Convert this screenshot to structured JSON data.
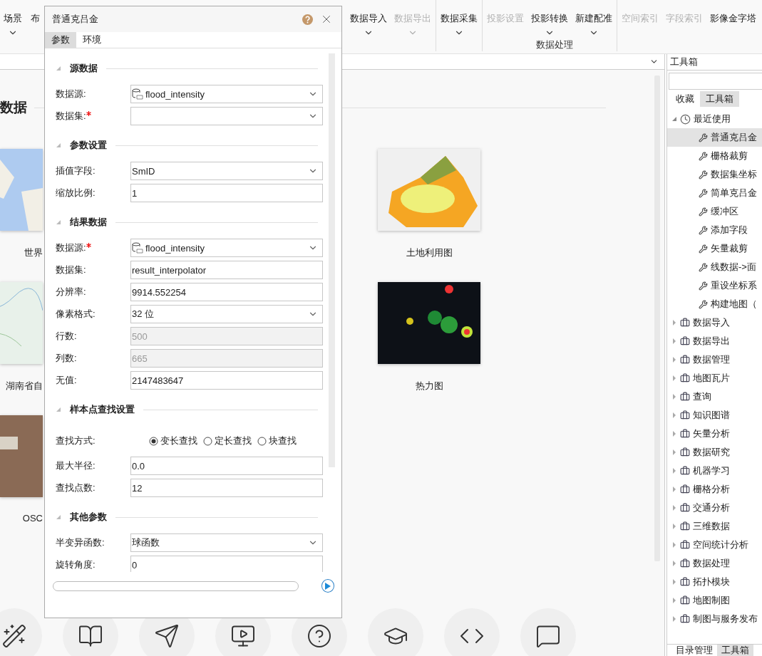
{
  "ribbon": {
    "left_items": [
      {
        "label": "场景",
        "menu": true
      },
      {
        "label": "布",
        "menu": false
      }
    ],
    "items": [
      {
        "kind": "button",
        "label": "数据导入",
        "disabled": false,
        "menu": true
      },
      {
        "kind": "button",
        "label": "数据导出",
        "disabled": true,
        "menu": true
      },
      {
        "kind": "separator"
      },
      {
        "kind": "button",
        "label": "数据采集",
        "disabled": false,
        "menu": true
      },
      {
        "kind": "separator"
      },
      {
        "kind": "button",
        "label": "投影设置",
        "disabled": true,
        "menu": false
      },
      {
        "kind": "button",
        "label": "投影转换",
        "disabled": false,
        "menu": true
      },
      {
        "kind": "button",
        "label": "新建配准",
        "disabled": false,
        "menu": true
      },
      {
        "kind": "separator"
      },
      {
        "kind": "button",
        "label": "空间索引",
        "disabled": true,
        "menu": false
      },
      {
        "kind": "button",
        "label": "字段索引",
        "disabled": true,
        "menu": false
      },
      {
        "kind": "button",
        "label": "影像金字塔",
        "disabled": false,
        "menu": false
      }
    ],
    "group_label": "数据处理"
  },
  "gallery": {
    "heading": "数据",
    "rows": [
      [
        {
          "label": "世界",
          "kind": "world-map"
        },
        {
          "label": "土地利用图",
          "kind": "land-use"
        }
      ],
      [
        {
          "label": "湖南省自",
          "kind": "terrain"
        },
        {
          "label": "热力图",
          "kind": "heatmap"
        }
      ],
      [
        {
          "label": "OSC",
          "kind": "aerial"
        }
      ]
    ]
  },
  "dialog": {
    "title": "普通克吕金",
    "tabs": [
      {
        "label": "参数",
        "selected": true
      },
      {
        "label": "环境",
        "selected": false
      }
    ],
    "sections": [
      {
        "title": "源数据",
        "expanded": true,
        "rows": [
          {
            "kind": "datasource",
            "label": "数据源:",
            "value": "flood_intensity",
            "required": false,
            "disabled": false
          },
          {
            "kind": "combo",
            "label": "数据集:",
            "value": "",
            "required": true,
            "disabled": false
          }
        ]
      },
      {
        "title": "参数设置",
        "expanded": true,
        "rows": [
          {
            "kind": "combo",
            "label": "插值字段:",
            "value": "SmID",
            "required": false,
            "disabled": false
          },
          {
            "kind": "text",
            "label": "缩放比例:",
            "value": "1",
            "required": false,
            "disabled": false
          }
        ]
      },
      {
        "title": "结果数据",
        "expanded": true,
        "rows": [
          {
            "kind": "datasource",
            "label": "数据源:",
            "value": "flood_intensity",
            "required": true,
            "disabled": false
          },
          {
            "kind": "text",
            "label": "数据集:",
            "value": "result_interpolator",
            "required": false,
            "disabled": false
          },
          {
            "kind": "text",
            "label": "分辨率:",
            "value": "9914.552254",
            "required": false,
            "disabled": false
          },
          {
            "kind": "combo",
            "label": "像素格式:",
            "value": "32 位",
            "required": false,
            "disabled": false
          },
          {
            "kind": "text",
            "label": "行数:",
            "value": "500",
            "required": false,
            "disabled": true
          },
          {
            "kind": "text",
            "label": "列数:",
            "value": "665",
            "required": false,
            "disabled": true
          },
          {
            "kind": "text",
            "label": "无值:",
            "value": "2147483647",
            "required": false,
            "disabled": false
          }
        ]
      },
      {
        "title": "样本点查找设置",
        "expanded": true,
        "rows": [
          {
            "kind": "radio",
            "label": "查找方式:",
            "options": [
              {
                "label": "变长查找",
                "selected": true
              },
              {
                "label": "定长查找",
                "selected": false
              },
              {
                "label": "块查找",
                "selected": false
              }
            ]
          },
          {
            "kind": "text",
            "label": "最大半径:",
            "value": "0.0",
            "required": false,
            "disabled": false
          },
          {
            "kind": "text",
            "label": "查找点数:",
            "value": "12",
            "required": false,
            "disabled": false
          }
        ]
      },
      {
        "title": "其他参数",
        "expanded": true,
        "rows": [
          {
            "kind": "combo",
            "label": "半变异函数:",
            "value": "球函数",
            "required": false,
            "disabled": false
          },
          {
            "kind": "text",
            "label": "旋转角度:",
            "value": "0",
            "required": false,
            "disabled": false
          }
        ]
      }
    ],
    "progress": {
      "level": 0
    }
  },
  "toolbox": {
    "title": "工具箱",
    "tabs": [
      {
        "label": "收藏",
        "selected": false
      },
      {
        "label": "工具箱",
        "selected": true
      }
    ],
    "tree": [
      {
        "kind": "recent",
        "label": "最近使用",
        "expanded": true,
        "selected": false,
        "children": [
          {
            "kind": "tool",
            "label": "普通克吕金",
            "selected": true
          },
          {
            "kind": "tool",
            "label": "栅格裁剪",
            "selected": false
          },
          {
            "kind": "tool",
            "label": "数据集坐标",
            "selected": false
          },
          {
            "kind": "tool",
            "label": "简单克吕金",
            "selected": false
          },
          {
            "kind": "tool",
            "label": "缓冲区",
            "selected": false
          },
          {
            "kind": "tool",
            "label": "添加字段",
            "selected": false
          },
          {
            "kind": "tool",
            "label": "矢量裁剪",
            "selected": false
          },
          {
            "kind": "tool",
            "label": "线数据->面",
            "selected": false
          },
          {
            "kind": "tool",
            "label": "重设坐标系",
            "selected": false
          },
          {
            "kind": "tool",
            "label": "构建地图（",
            "selected": false
          }
        ]
      },
      {
        "kind": "group",
        "label": "数据导入",
        "expanded": false,
        "selected": false
      },
      {
        "kind": "group",
        "label": "数据导出",
        "expanded": false,
        "selected": false
      },
      {
        "kind": "group",
        "label": "数据管理",
        "expanded": false,
        "selected": false
      },
      {
        "kind": "group",
        "label": "地图瓦片",
        "expanded": false,
        "selected": false
      },
      {
        "kind": "group",
        "label": "查询",
        "expanded": false,
        "selected": false
      },
      {
        "kind": "group",
        "label": "知识图谱",
        "expanded": false,
        "selected": false
      },
      {
        "kind": "group",
        "label": "矢量分析",
        "expanded": false,
        "selected": false
      },
      {
        "kind": "group",
        "label": "数据研究",
        "expanded": false,
        "selected": false
      },
      {
        "kind": "group",
        "label": "机器学习",
        "expanded": false,
        "selected": false
      },
      {
        "kind": "group",
        "label": "栅格分析",
        "expanded": false,
        "selected": false
      },
      {
        "kind": "group",
        "label": "交通分析",
        "expanded": false,
        "selected": false
      },
      {
        "kind": "group",
        "label": "三维数据",
        "expanded": false,
        "selected": false
      },
      {
        "kind": "group",
        "label": "空间统计分析",
        "expanded": false,
        "selected": false
      },
      {
        "kind": "group",
        "label": "数据处理",
        "expanded": false,
        "selected": false
      },
      {
        "kind": "group",
        "label": "拓扑模块",
        "expanded": false,
        "selected": false
      },
      {
        "kind": "group",
        "label": "地图制图",
        "expanded": false,
        "selected": false
      },
      {
        "kind": "group",
        "label": "制图与服务发布",
        "expanded": false,
        "selected": false
      }
    ],
    "bottom_tabs": [
      {
        "label": "目录管理",
        "selected": false
      },
      {
        "label": "工具箱",
        "selected": true
      }
    ]
  }
}
